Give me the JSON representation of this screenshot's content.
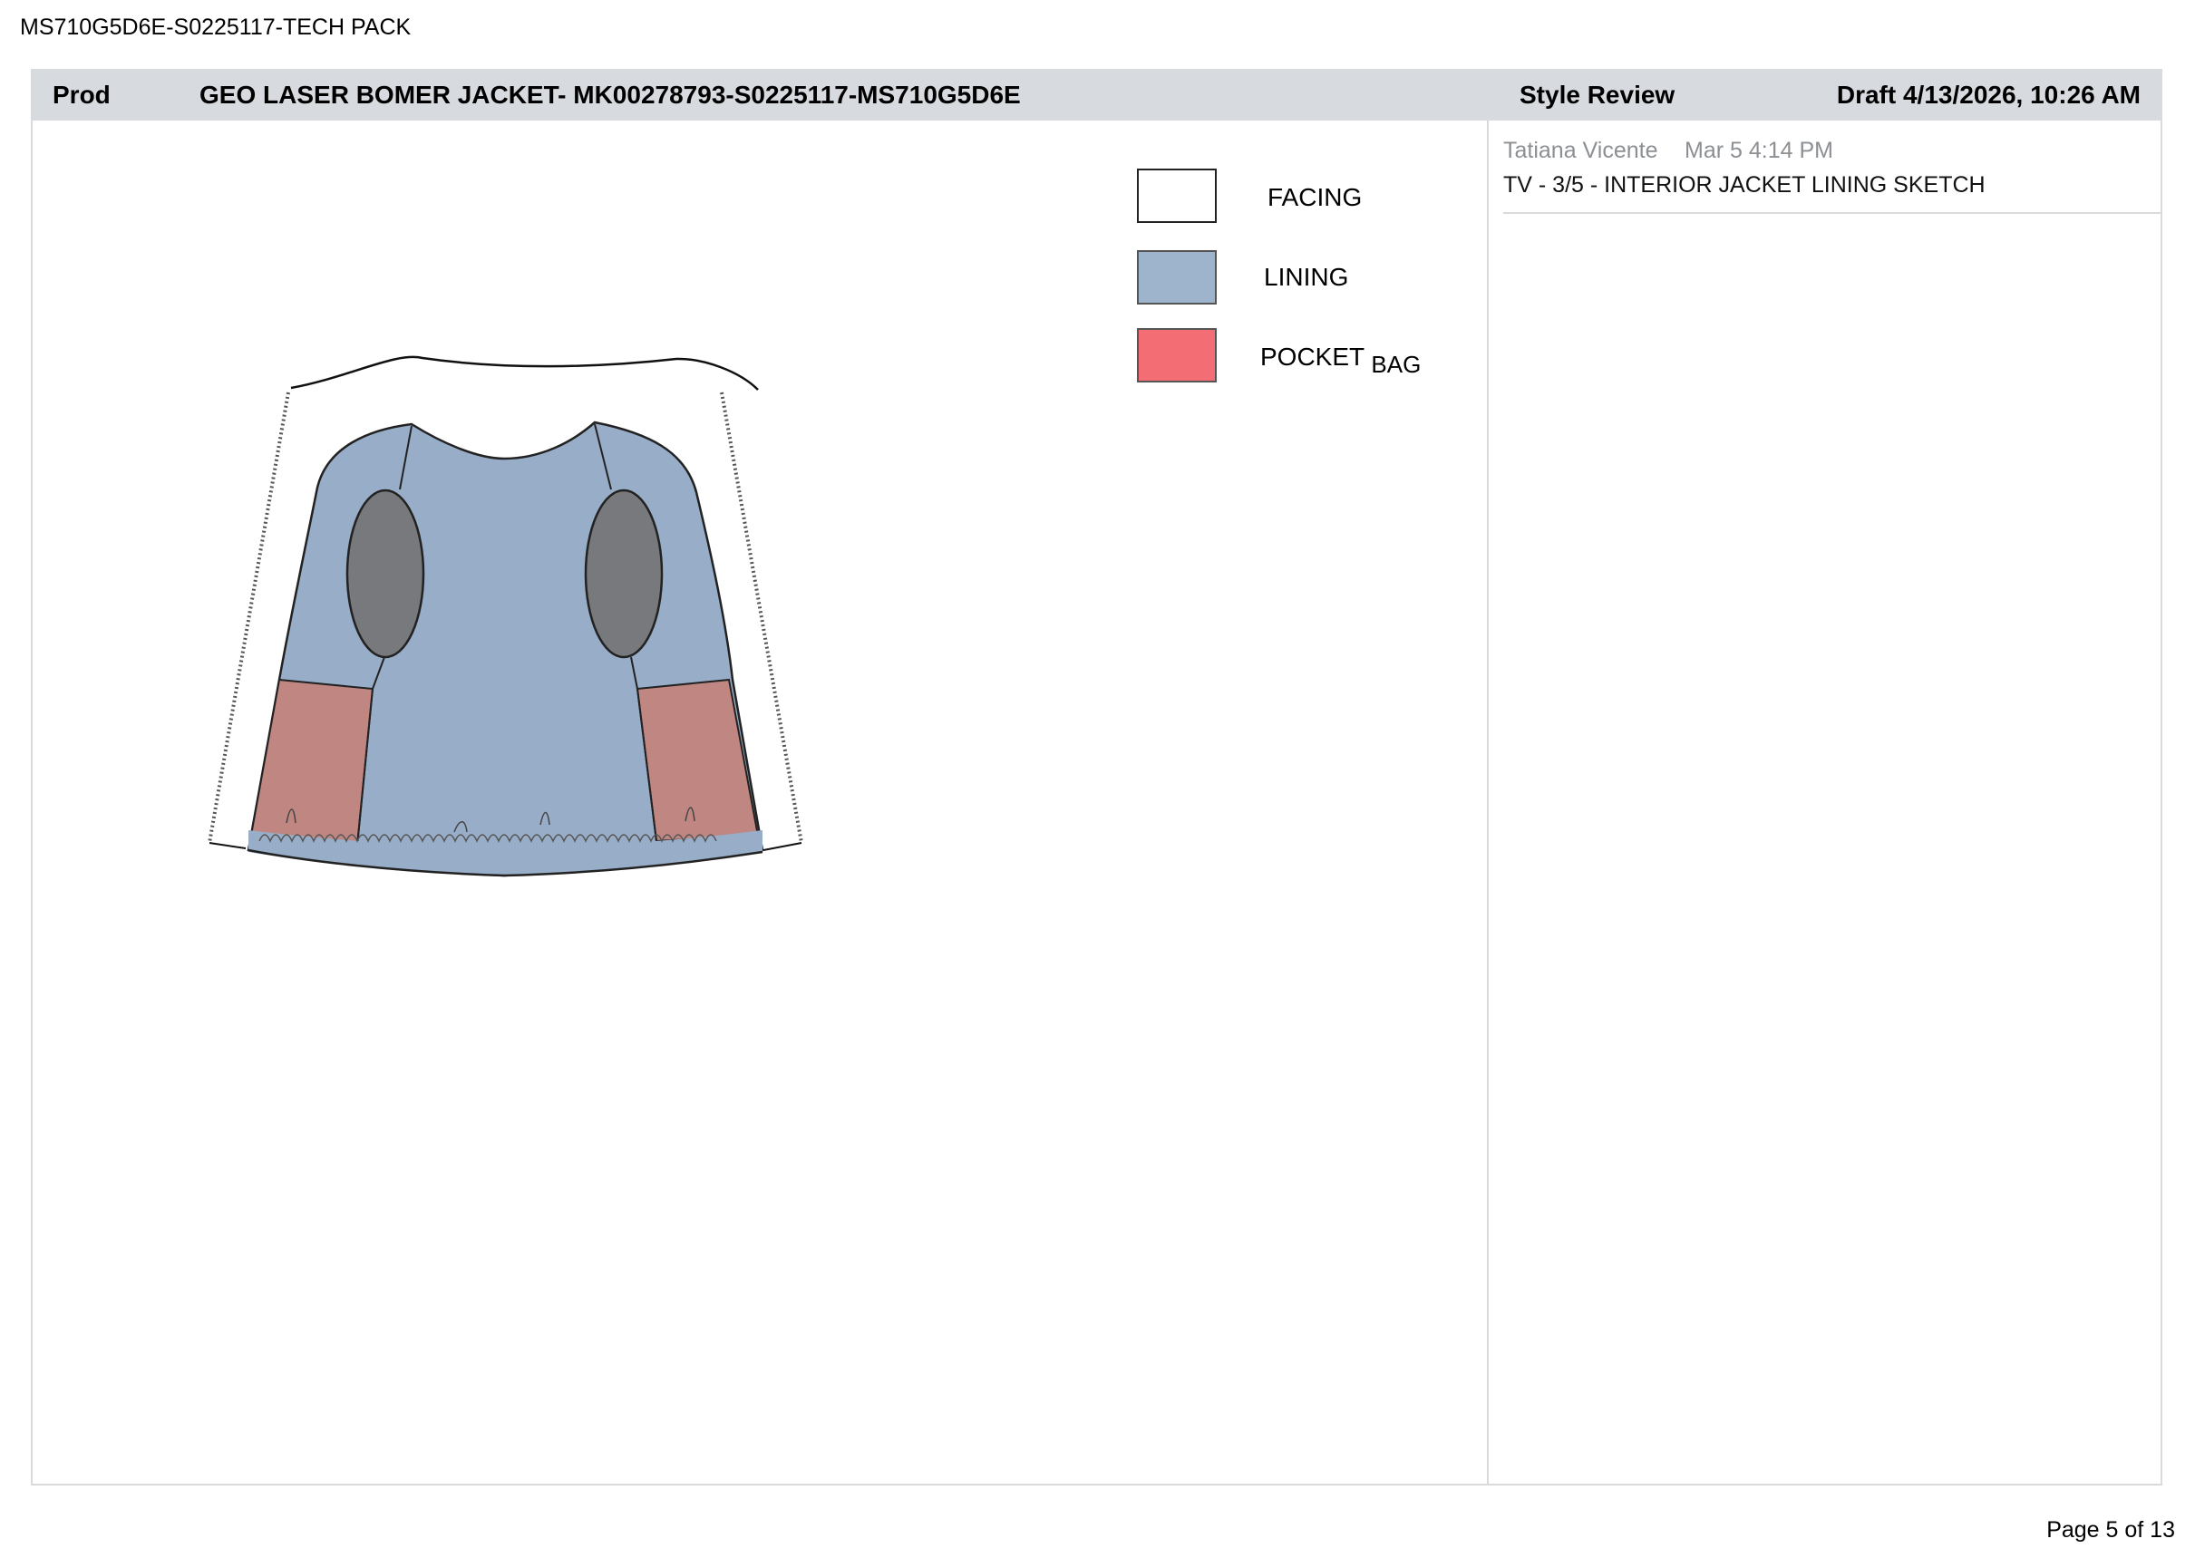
{
  "document": {
    "id_header": "MS710G5D6E-S0225117-TECH PACK",
    "page_label": "Page 5 of 13"
  },
  "header": {
    "section": "Prod",
    "title": "GEO LASER BOMER JACKET- MK00278793-S0225117-MS710G5D6E",
    "review": "Style Review",
    "status": "Draft 4/13/2026, 10:26 AM"
  },
  "legend": [
    {
      "label": "FACING",
      "sub": "",
      "color": "#ffffff"
    },
    {
      "label": "LINING",
      "sub": "",
      "color": "#9db4cc"
    },
    {
      "label": "POCKET",
      "sub": "BAG",
      "color": "#f26d74"
    }
  ],
  "comment": {
    "author": "Tatiana Vicente",
    "time": "Mar 5 4:14 PM",
    "text": "TV - 3/5 - INTERIOR JACKET LINING SKETCH"
  },
  "colors": {
    "lining": "#98adc7",
    "pocket": "#bf8682",
    "armhole": "#77797c",
    "header_bg": "#d7dade"
  }
}
